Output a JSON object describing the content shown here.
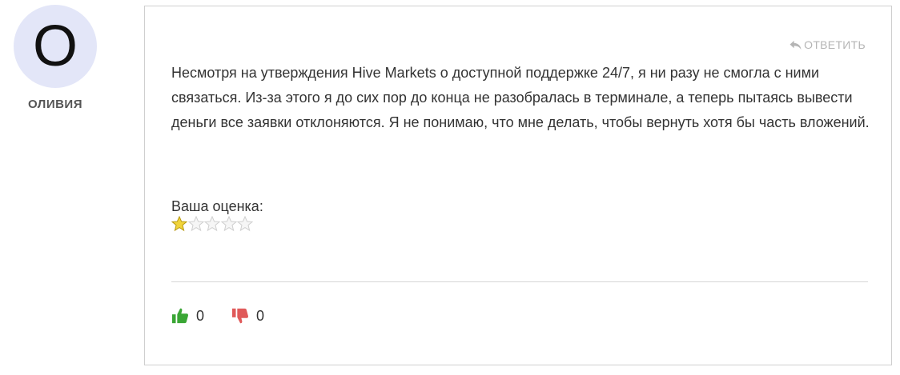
{
  "author": {
    "initial": "О",
    "name": "ОЛИВИЯ",
    "avatar_color": "#e3e6f8"
  },
  "comment": {
    "reply_label": "ОТВЕТИТЬ",
    "text": "Несмотря на утверждения Hive Markets о доступной поддержке 24/7, я ни разу не смогла с ними связаться. Из-за этого я до сих пор до конца не разобралась в терминале, а теперь пытаясь вывести деньги все заявки отклоняются. Я не понимаю, что мне делать, чтобы вернуть хотя бы часть вложений.",
    "rating_label": "Ваша оценка:",
    "rating": 1,
    "rating_max": 5
  },
  "votes": {
    "likes": "0",
    "dislikes": "0",
    "like_color": "#3aa635",
    "dislike_color": "#e05a5a"
  }
}
